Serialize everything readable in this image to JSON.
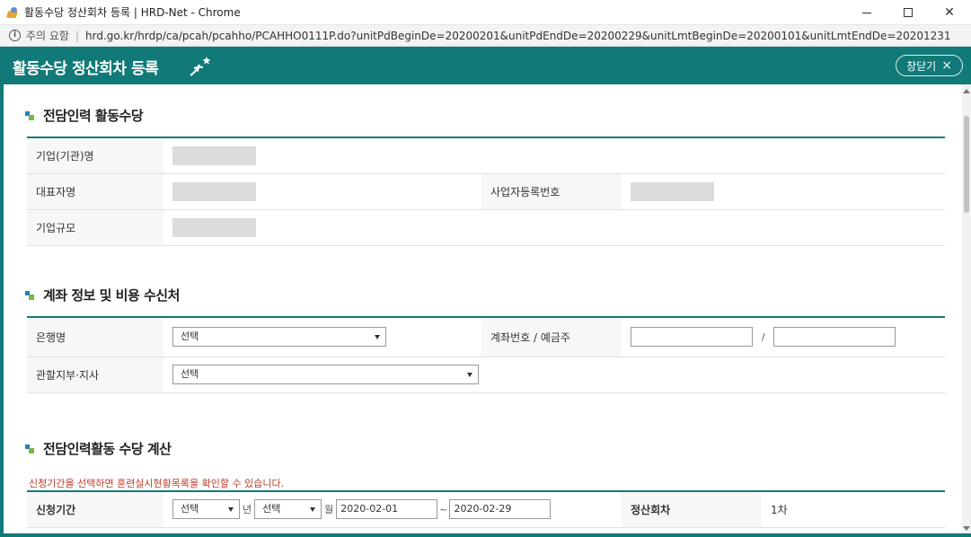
{
  "window": {
    "title": "활동수당 정산회차 등록 | HRD-Net - Chrome"
  },
  "addressbar": {
    "warning": "주의 요함",
    "url": "hrd.go.kr/hrdp/ca/pcah/pcahho/PCAHHO0111P.do?unitPdBeginDe=20200201&unitPdEndDe=20200229&unitLmtBeginDe=20200101&unitLmtEndDe=20201231"
  },
  "header": {
    "title": "활동수당 정산회차 등록",
    "close_label": "창닫기",
    "close_icon": "×"
  },
  "section1": {
    "title": "전담인력 활동수당",
    "rows": {
      "company_label": "기업(기관)명",
      "ceo_label": "대표자명",
      "bizno_label": "사업자등록번호",
      "size_label": "기업규모"
    }
  },
  "section2": {
    "title": "계좌 정보 및 비용 수신처",
    "bank_label": "은행명",
    "bank_value": "선택",
    "account_label": "계좌번호  / 예금주",
    "account_value": "",
    "holder_value": "",
    "account_sep": "/",
    "branch_label": "관할지부·지사",
    "branch_value": "선택"
  },
  "section3": {
    "title": "전담인력활동 수당 계산",
    "notice": "신청기간을 선택하면 훈련실시현황목록을 확인할 수 있습니다.",
    "period_label": "신청기간",
    "year_value": "선택",
    "year_unit": "년",
    "month_value": "선택",
    "month_unit": "월",
    "start_date": "2020-02-01",
    "tilde": "~",
    "end_date": "2020-02-29",
    "round_label": "정산회차",
    "round_value": "1차"
  },
  "colors": {
    "accent": "#117a78",
    "notice": "#c0392b"
  }
}
